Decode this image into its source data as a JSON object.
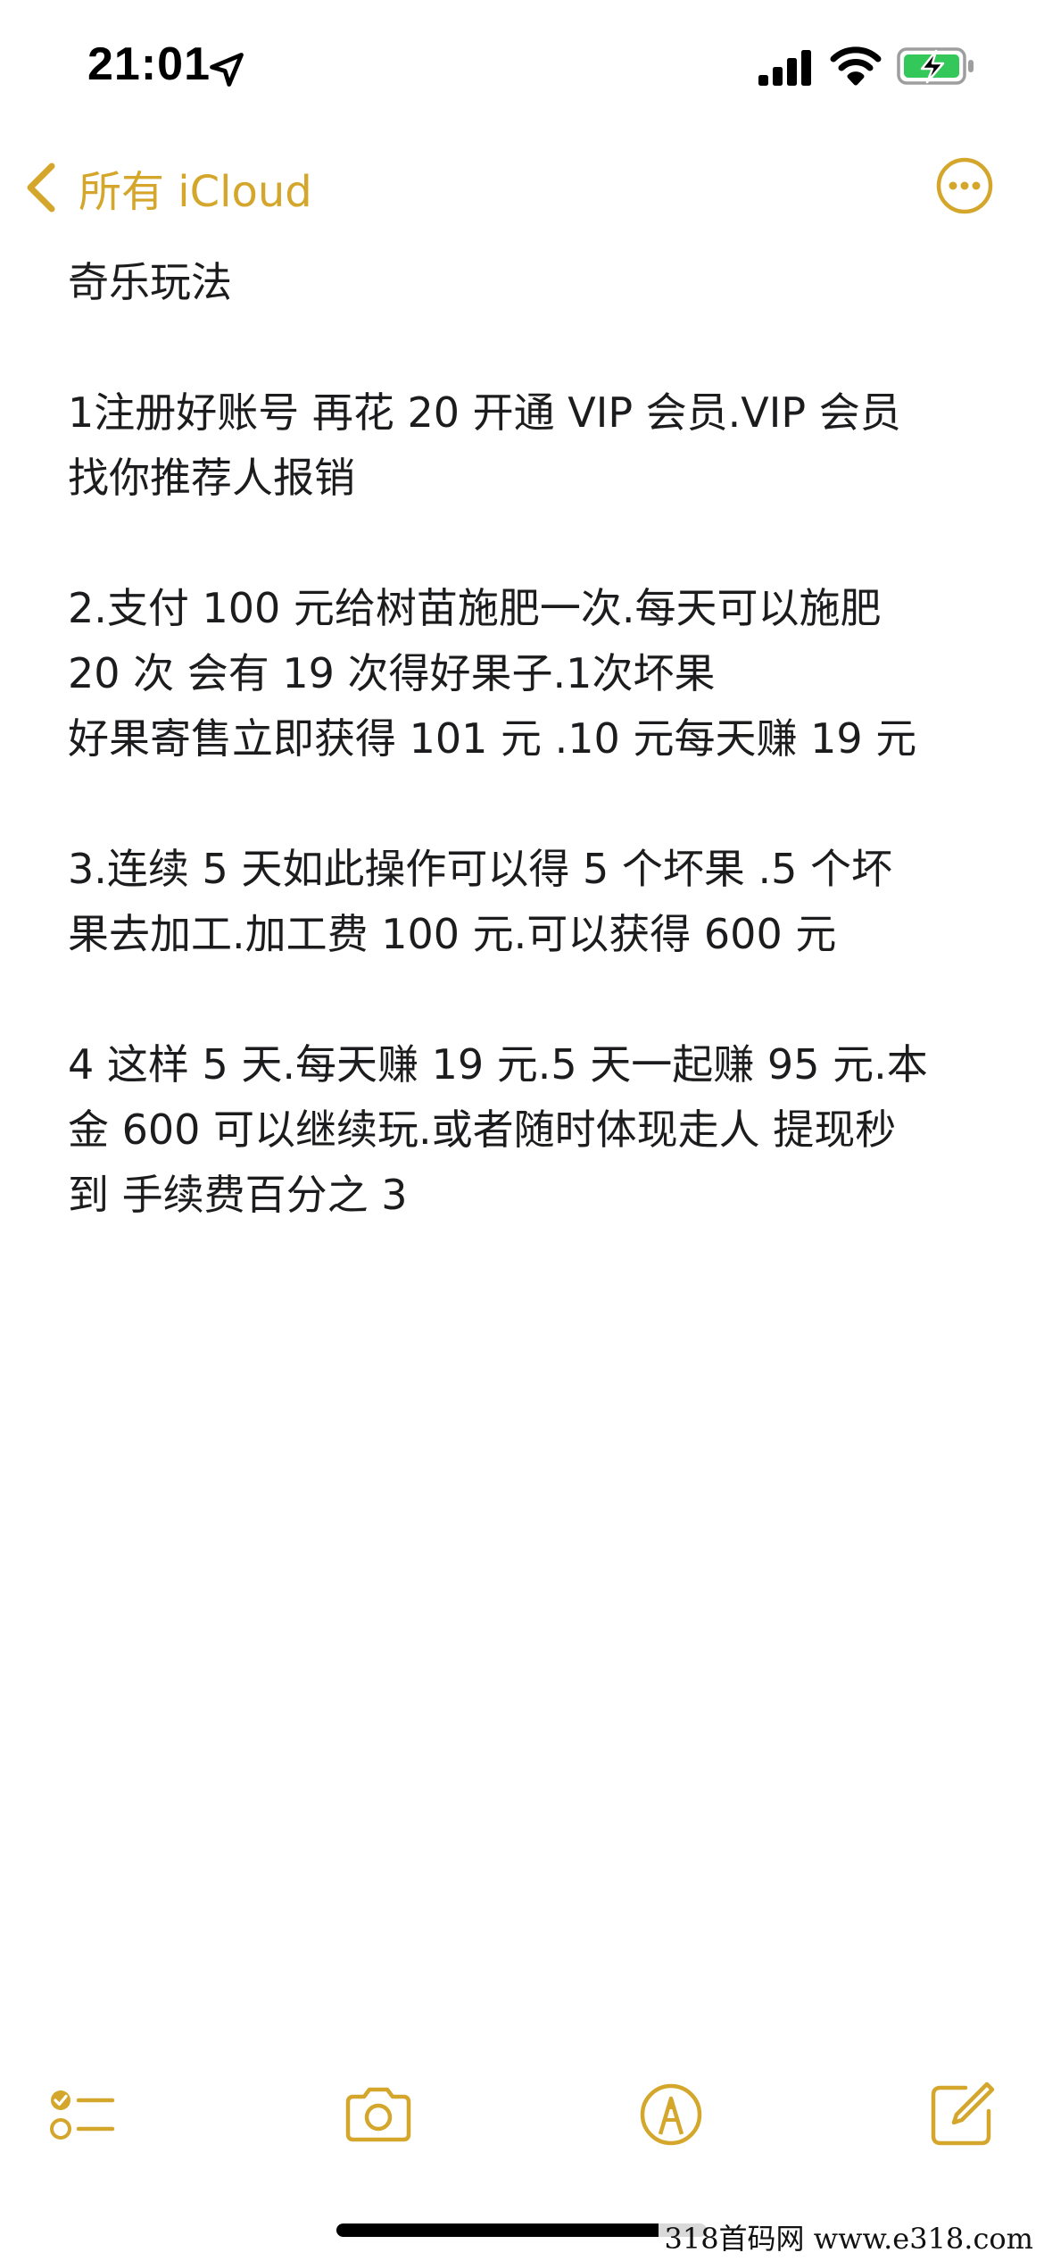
{
  "status_bar": {
    "time": "21:01",
    "icons": [
      "location-arrow-icon",
      "cellular-signal-icon",
      "wifi-icon",
      "battery-charging-icon"
    ],
    "battery_color": "#34c759"
  },
  "nav": {
    "back_label": "所有 iCloud",
    "more_icon": "ellipsis-circle-icon",
    "accent_color": "#d4a72c"
  },
  "note": {
    "title": "奇乐玩法",
    "paragraphs": [
      [
        "1注册好账号 再花 20 开通 VIP 会员.VIP 会员",
        "找你推荐人报销"
      ],
      [
        "2.支付 100 元给树苗施肥一次.每天可以施肥",
        "20 次 会有 19 次得好果子.1次坏果",
        "好果寄售立即获得 101 元 .10 元每天赚 19 元"
      ],
      [
        "3.连续 5 天如此操作可以得 5 个坏果 .5 个坏",
        "果去加工.加工费 100 元.可以获得 600 元"
      ],
      [
        "4 这样 5 天.每天赚 19 元.5 天一起赚 95 元.本",
        "金 600 可以继续玩.或者随时体现走人 提现秒",
        "到 手续费百分之 3"
      ]
    ]
  },
  "toolbar": {
    "icons": [
      "checklist-icon",
      "camera-icon",
      "markup-pen-icon",
      "compose-icon"
    ]
  },
  "watermark": "318首码网  www.e318.com"
}
